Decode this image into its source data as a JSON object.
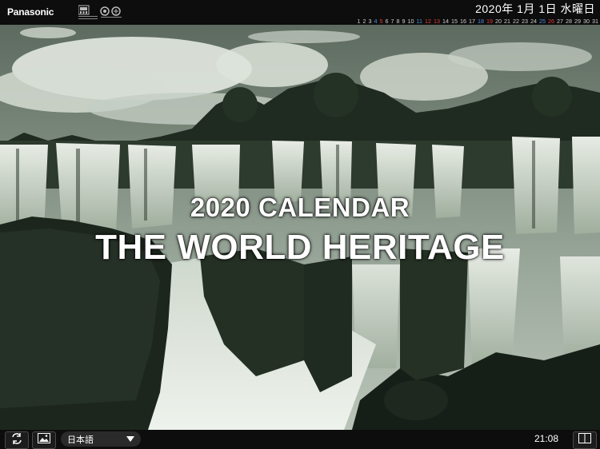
{
  "header": {
    "brand": "Panasonic",
    "date": "2020年 1月 1日 水曜日",
    "days": [
      "1",
      "2",
      "3",
      "4",
      "5",
      "6",
      "7",
      "8",
      "9",
      "10",
      "11",
      "12",
      "13",
      "14",
      "15",
      "16",
      "17",
      "18",
      "19",
      "20",
      "21",
      "22",
      "23",
      "24",
      "25",
      "26",
      "27",
      "28",
      "29",
      "30",
      "31"
    ],
    "day_colors": {
      "4": "#4f8fe0",
      "5": "#e23c3c",
      "11": "#4f8fe0",
      "12": "#e23c3c",
      "13": "#e23c3c",
      "18": "#4f8fe0",
      "19": "#e23c3c",
      "25": "#4f8fe0",
      "26": "#e23c3c"
    }
  },
  "hero": {
    "title_line1": "2020 CALENDAR",
    "title_line2": "THE WORLD HERITAGE"
  },
  "footer": {
    "language": "日本語",
    "time": "21:08"
  },
  "icons": {
    "refresh": "refresh-icon",
    "image": "image-icon",
    "book": "book-icon"
  }
}
